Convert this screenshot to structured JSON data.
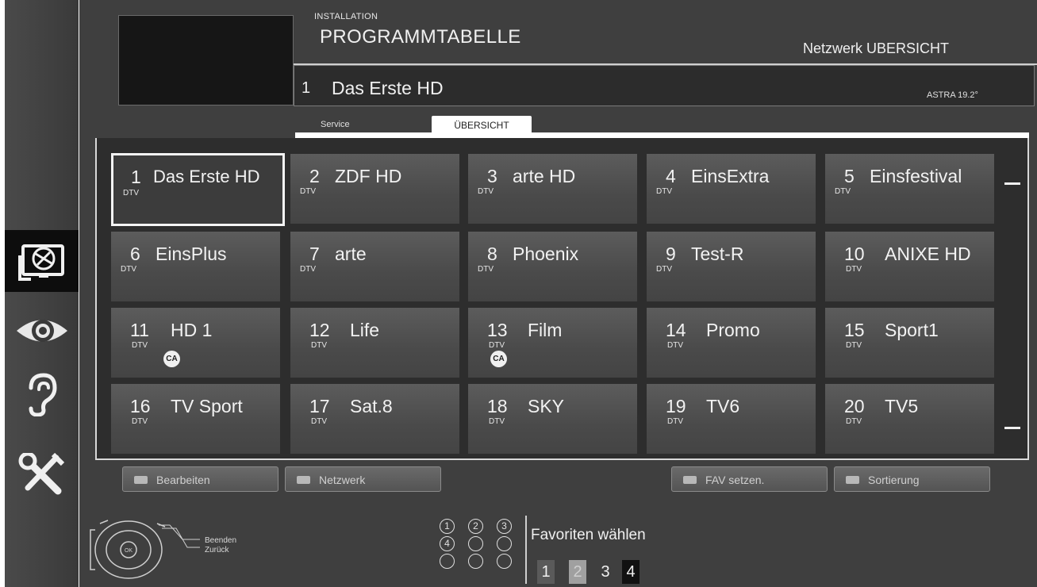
{
  "header": {
    "section": "INSTALLATION",
    "title": "PROGRAMMTABELLE",
    "network_overview": "Netzwerk UBERSICHT"
  },
  "selected_channel": {
    "number": "1",
    "name": "Das Erste HD",
    "satellite": "ASTRA 19.2°"
  },
  "tabs": [
    {
      "label": "Service",
      "active": false
    },
    {
      "label": "ÜBERSICHT",
      "active": true
    }
  ],
  "channels": [
    {
      "num": "1",
      "name": "Das Erste HD",
      "type": "DTV",
      "ca": false,
      "selected": true
    },
    {
      "num": "2",
      "name": "ZDF HD",
      "type": "DTV",
      "ca": false
    },
    {
      "num": "3",
      "name": "arte HD",
      "type": "DTV",
      "ca": false
    },
    {
      "num": "4",
      "name": "EinsExtra",
      "type": "DTV",
      "ca": false
    },
    {
      "num": "5",
      "name": "Einsfestival",
      "type": "DTV",
      "ca": false
    },
    {
      "num": "6",
      "name": "EinsPlus",
      "type": "DTV",
      "ca": false
    },
    {
      "num": "7",
      "name": "arte",
      "type": "DTV",
      "ca": false
    },
    {
      "num": "8",
      "name": "Phoenix",
      "type": "DTV",
      "ca": false
    },
    {
      "num": "9",
      "name": "Test-R",
      "type": "DTV",
      "ca": false
    },
    {
      "num": "10",
      "name": "ANIXE HD",
      "type": "DTV",
      "ca": false
    },
    {
      "num": "11",
      "name": "HD 1",
      "type": "DTV",
      "ca": true
    },
    {
      "num": "12",
      "name": "Life",
      "type": "DTV",
      "ca": false
    },
    {
      "num": "13",
      "name": "Film",
      "type": "DTV",
      "ca": true
    },
    {
      "num": "14",
      "name": "Promo",
      "type": "DTV",
      "ca": false
    },
    {
      "num": "15",
      "name": "Sport1",
      "type": "DTV",
      "ca": false
    },
    {
      "num": "16",
      "name": "TV Sport",
      "type": "DTV",
      "ca": false
    },
    {
      "num": "17",
      "name": "Sat.8",
      "type": "DTV",
      "ca": false
    },
    {
      "num": "18",
      "name": "SKY",
      "type": "DTV",
      "ca": false
    },
    {
      "num": "19",
      "name": "TV6",
      "type": "DTV",
      "ca": false
    },
    {
      "num": "20",
      "name": "TV5",
      "type": "DTV",
      "ca": false
    }
  ],
  "ca_badge": "CA",
  "function_buttons": {
    "edit": "Bearbeiten",
    "network": "Netzwerk",
    "fav": "FAV setzen.",
    "sort": "Sortierung"
  },
  "remote_hints": {
    "end": "Beenden",
    "back": "Zurück",
    "ok": "OK"
  },
  "favorites": {
    "label": "Favoriten wählen",
    "keys": [
      "1",
      "2",
      "3",
      "4",
      "",
      "",
      "",
      "",
      ""
    ],
    "lists": [
      "1",
      "2",
      "3",
      "4"
    ]
  },
  "sidebar": {
    "items": [
      {
        "icon": "satellite-dish-icon",
        "active": true
      },
      {
        "icon": "eye-icon",
        "active": false
      },
      {
        "icon": "ear-icon",
        "active": false
      },
      {
        "icon": "tools-icon",
        "active": false
      }
    ]
  },
  "colors": {
    "panel": "#3f3f3f",
    "cell": "#4f4f4f",
    "selected_border": "#f4f4f4",
    "rail": "#404040"
  }
}
